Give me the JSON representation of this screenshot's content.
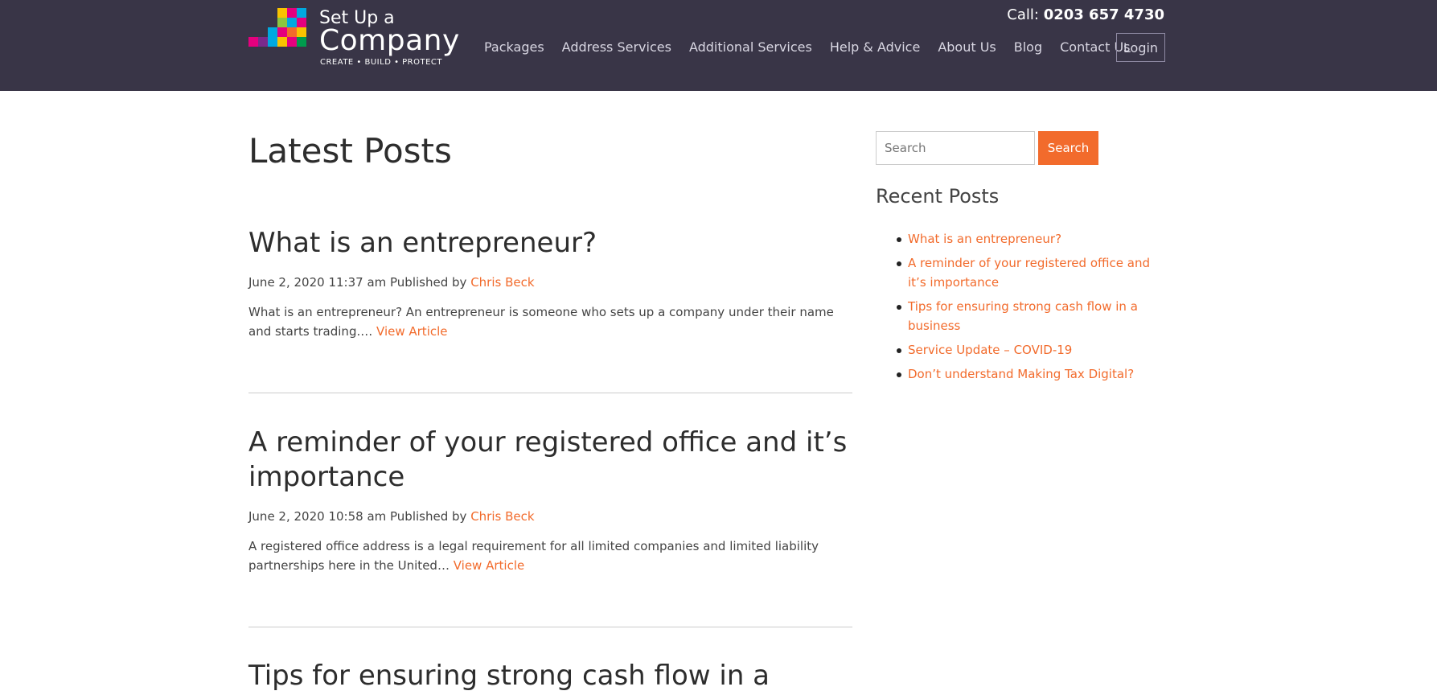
{
  "header": {
    "logo": {
      "line1": "Set Up a",
      "line2": "Company",
      "tagline": "CREATE • BUILD • PROTECT",
      "colors": [
        "#e5007e",
        "#f9c300",
        "#00a9e0",
        "#8dc63f",
        "#f26b2c",
        "#009b4d",
        "#7a2a8c"
      ]
    },
    "phone": {
      "label": "Call:",
      "number": "0203 657 4730"
    },
    "nav": [
      {
        "label": "Packages"
      },
      {
        "label": "Address Services"
      },
      {
        "label": "Additional Services"
      },
      {
        "label": "Help & Advice"
      },
      {
        "label": "About Us"
      },
      {
        "label": "Blog"
      },
      {
        "label": "Contact Us"
      }
    ],
    "login_label": "Login"
  },
  "main": {
    "title": "Latest Posts",
    "posts": [
      {
        "title": "What is an entrepreneur?",
        "meta_date": "June 2, 2020 11:37 am Published by",
        "author": "Chris Beck",
        "excerpt": " What is an entrepreneur? An entrepreneur is someone who sets up a company under their name and starts trading.…",
        "link_label": "View Article"
      },
      {
        "title": "A reminder of your registered office and it’s importance",
        "meta_date": "June 2, 2020 10:58 am Published by",
        "author": "Chris Beck",
        "excerpt": "A registered office address is a legal requirement for all limited companies and limited liability partnerships here in the United…",
        "link_label": "View Article"
      },
      {
        "title": "Tips for ensuring strong cash flow in a"
      }
    ]
  },
  "sidebar": {
    "search_placeholder": "Search",
    "search_button": "Search",
    "recent_title": "Recent Posts",
    "recent_posts": [
      "What is an entrepreneur?",
      "A reminder of your registered office and it’s importance",
      "Tips for ensuring strong cash flow in a business",
      "Service Update – COVID-19",
      "Don’t understand Making Tax Digital?"
    ]
  },
  "colors": {
    "header_bg": "#393547",
    "accent": "#f26b2c"
  }
}
